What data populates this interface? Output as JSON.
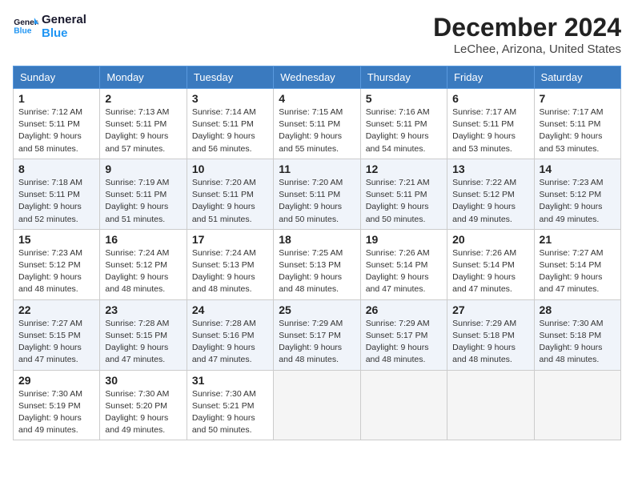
{
  "header": {
    "logo_line1": "General",
    "logo_line2": "Blue",
    "month_title": "December 2024",
    "location": "LeChee, Arizona, United States"
  },
  "weekdays": [
    "Sunday",
    "Monday",
    "Tuesday",
    "Wednesday",
    "Thursday",
    "Friday",
    "Saturday"
  ],
  "weeks": [
    [
      {
        "day": "1",
        "info": "Sunrise: 7:12 AM\nSunset: 5:11 PM\nDaylight: 9 hours\nand 58 minutes."
      },
      {
        "day": "2",
        "info": "Sunrise: 7:13 AM\nSunset: 5:11 PM\nDaylight: 9 hours\nand 57 minutes."
      },
      {
        "day": "3",
        "info": "Sunrise: 7:14 AM\nSunset: 5:11 PM\nDaylight: 9 hours\nand 56 minutes."
      },
      {
        "day": "4",
        "info": "Sunrise: 7:15 AM\nSunset: 5:11 PM\nDaylight: 9 hours\nand 55 minutes."
      },
      {
        "day": "5",
        "info": "Sunrise: 7:16 AM\nSunset: 5:11 PM\nDaylight: 9 hours\nand 54 minutes."
      },
      {
        "day": "6",
        "info": "Sunrise: 7:17 AM\nSunset: 5:11 PM\nDaylight: 9 hours\nand 53 minutes."
      },
      {
        "day": "7",
        "info": "Sunrise: 7:17 AM\nSunset: 5:11 PM\nDaylight: 9 hours\nand 53 minutes."
      }
    ],
    [
      {
        "day": "8",
        "info": "Sunrise: 7:18 AM\nSunset: 5:11 PM\nDaylight: 9 hours\nand 52 minutes."
      },
      {
        "day": "9",
        "info": "Sunrise: 7:19 AM\nSunset: 5:11 PM\nDaylight: 9 hours\nand 51 minutes."
      },
      {
        "day": "10",
        "info": "Sunrise: 7:20 AM\nSunset: 5:11 PM\nDaylight: 9 hours\nand 51 minutes."
      },
      {
        "day": "11",
        "info": "Sunrise: 7:20 AM\nSunset: 5:11 PM\nDaylight: 9 hours\nand 50 minutes."
      },
      {
        "day": "12",
        "info": "Sunrise: 7:21 AM\nSunset: 5:11 PM\nDaylight: 9 hours\nand 50 minutes."
      },
      {
        "day": "13",
        "info": "Sunrise: 7:22 AM\nSunset: 5:12 PM\nDaylight: 9 hours\nand 49 minutes."
      },
      {
        "day": "14",
        "info": "Sunrise: 7:23 AM\nSunset: 5:12 PM\nDaylight: 9 hours\nand 49 minutes."
      }
    ],
    [
      {
        "day": "15",
        "info": "Sunrise: 7:23 AM\nSunset: 5:12 PM\nDaylight: 9 hours\nand 48 minutes."
      },
      {
        "day": "16",
        "info": "Sunrise: 7:24 AM\nSunset: 5:12 PM\nDaylight: 9 hours\nand 48 minutes."
      },
      {
        "day": "17",
        "info": "Sunrise: 7:24 AM\nSunset: 5:13 PM\nDaylight: 9 hours\nand 48 minutes."
      },
      {
        "day": "18",
        "info": "Sunrise: 7:25 AM\nSunset: 5:13 PM\nDaylight: 9 hours\nand 48 minutes."
      },
      {
        "day": "19",
        "info": "Sunrise: 7:26 AM\nSunset: 5:14 PM\nDaylight: 9 hours\nand 47 minutes."
      },
      {
        "day": "20",
        "info": "Sunrise: 7:26 AM\nSunset: 5:14 PM\nDaylight: 9 hours\nand 47 minutes."
      },
      {
        "day": "21",
        "info": "Sunrise: 7:27 AM\nSunset: 5:14 PM\nDaylight: 9 hours\nand 47 minutes."
      }
    ],
    [
      {
        "day": "22",
        "info": "Sunrise: 7:27 AM\nSunset: 5:15 PM\nDaylight: 9 hours\nand 47 minutes."
      },
      {
        "day": "23",
        "info": "Sunrise: 7:28 AM\nSunset: 5:15 PM\nDaylight: 9 hours\nand 47 minutes."
      },
      {
        "day": "24",
        "info": "Sunrise: 7:28 AM\nSunset: 5:16 PM\nDaylight: 9 hours\nand 47 minutes."
      },
      {
        "day": "25",
        "info": "Sunrise: 7:29 AM\nSunset: 5:17 PM\nDaylight: 9 hours\nand 48 minutes."
      },
      {
        "day": "26",
        "info": "Sunrise: 7:29 AM\nSunset: 5:17 PM\nDaylight: 9 hours\nand 48 minutes."
      },
      {
        "day": "27",
        "info": "Sunrise: 7:29 AM\nSunset: 5:18 PM\nDaylight: 9 hours\nand 48 minutes."
      },
      {
        "day": "28",
        "info": "Sunrise: 7:30 AM\nSunset: 5:18 PM\nDaylight: 9 hours\nand 48 minutes."
      }
    ],
    [
      {
        "day": "29",
        "info": "Sunrise: 7:30 AM\nSunset: 5:19 PM\nDaylight: 9 hours\nand 49 minutes."
      },
      {
        "day": "30",
        "info": "Sunrise: 7:30 AM\nSunset: 5:20 PM\nDaylight: 9 hours\nand 49 minutes."
      },
      {
        "day": "31",
        "info": "Sunrise: 7:30 AM\nSunset: 5:21 PM\nDaylight: 9 hours\nand 50 minutes."
      },
      null,
      null,
      null,
      null
    ]
  ]
}
